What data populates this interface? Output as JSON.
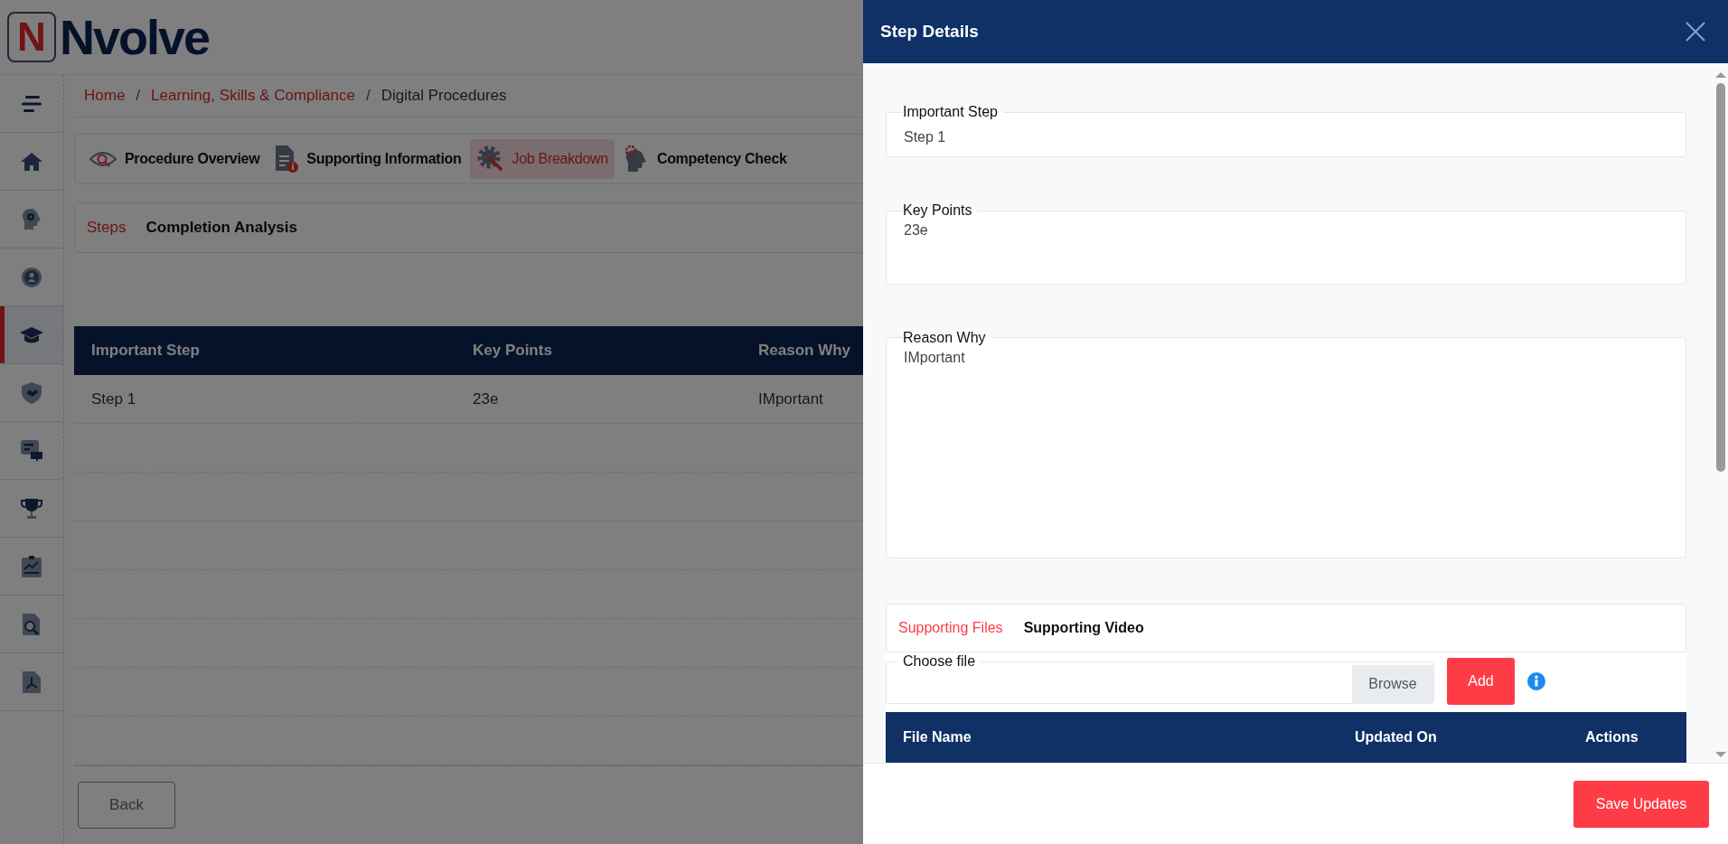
{
  "brand": {
    "letter": "N",
    "name": "Nvolve"
  },
  "sidebar": {
    "items": [
      {
        "selected": false
      },
      {
        "selected": false
      },
      {
        "selected": false
      },
      {
        "selected": true
      },
      {
        "selected": false
      },
      {
        "selected": false
      },
      {
        "selected": false
      },
      {
        "selected": false
      },
      {
        "selected": false
      },
      {
        "selected": false
      }
    ]
  },
  "breadcrumbs": [
    {
      "label": "Home",
      "link": true
    },
    {
      "separator": "/",
      "label": "Learning, Skills & Compliance",
      "link": true
    },
    {
      "separator": "/",
      "label": "Digital Procedures",
      "link": false
    }
  ],
  "tabs": [
    {
      "label": "Procedure Overview",
      "selected": false
    },
    {
      "label": "Supporting Information",
      "selected": false
    },
    {
      "label": "Job Breakdown",
      "selected": true
    },
    {
      "label": "Competency Check",
      "selected": false
    }
  ],
  "subtabs": [
    {
      "label": "Steps",
      "selected": true
    },
    {
      "label": "Completion Analysis",
      "selected": false
    }
  ],
  "table": {
    "columns": [
      "Important Step",
      "Key Points",
      "Reason Why"
    ],
    "rows": [
      [
        "Step 1",
        "23e",
        "IMportant"
      ]
    ]
  },
  "back_button": "Back",
  "drawer": {
    "title": "Step Details",
    "fields": [
      {
        "label": "Important Step",
        "value": "Step 1",
        "kind": "line"
      },
      {
        "label": "Key Points",
        "value": "23e",
        "kind": "box"
      },
      {
        "label": "Reason Why",
        "value": "IMportant",
        "kind": "tall-box"
      }
    ],
    "support_tabs": [
      {
        "label": "Supporting Files",
        "selected": true
      },
      {
        "label": "Supporting Video",
        "selected": false
      }
    ],
    "file_input": {
      "label": "Choose file",
      "button": "Browse"
    },
    "add_button": "Add",
    "files_table": {
      "columns": [
        "File Name",
        "Updated On",
        "Actions"
      ]
    },
    "save_button": "Save Updates"
  }
}
